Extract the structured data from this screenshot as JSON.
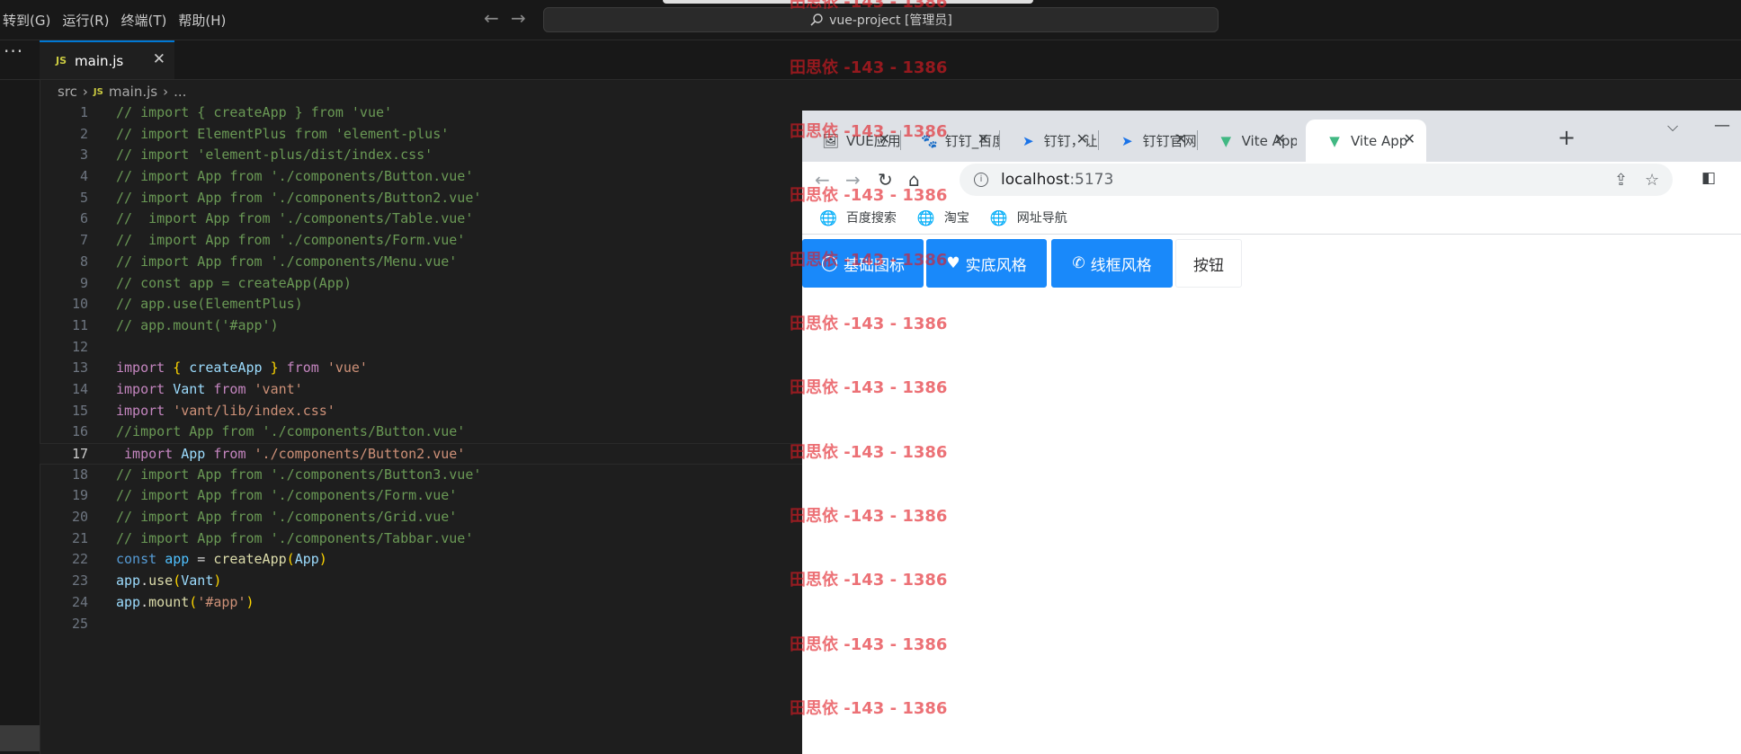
{
  "vscode": {
    "menu": [
      "转到(G)",
      "运行(R)",
      "终端(T)",
      "帮助(H)"
    ],
    "command_center": "vue-project [管理员]",
    "tab": {
      "label": "main.js",
      "badge": "JS"
    },
    "breadcrumb": {
      "folder": "src",
      "badge": "JS",
      "file": "main.js",
      "rest": "..."
    },
    "active_line": 17,
    "code": [
      [
        [
          "cm",
          "// import { createApp } from 'vue'"
        ]
      ],
      [
        [
          "cm",
          "// import ElementPlus from 'element-plus'"
        ]
      ],
      [
        [
          "cm",
          "// import 'element-plus/dist/index.css'"
        ]
      ],
      [
        [
          "cm",
          "// import App from './components/Button.vue'"
        ]
      ],
      [
        [
          "cm",
          "// import App from './components/Button2.vue'"
        ]
      ],
      [
        [
          "cm",
          "//  import App from './components/Table.vue'"
        ]
      ],
      [
        [
          "cm",
          "//  import App from './components/Form.vue'"
        ]
      ],
      [
        [
          "cm",
          "// import App from './components/Menu.vue'"
        ]
      ],
      [
        [
          "cm",
          "// const app = createApp(App)"
        ]
      ],
      [
        [
          "cm",
          "// app.use(ElementPlus)"
        ]
      ],
      [
        [
          "cm",
          "// app.mount('#app')"
        ]
      ],
      [],
      [
        [
          "kw",
          "import"
        ],
        [
          "pl",
          " "
        ],
        [
          "pn",
          "{"
        ],
        [
          "pl",
          " "
        ],
        [
          "id",
          "createApp"
        ],
        [
          "pl",
          " "
        ],
        [
          "pn",
          "}"
        ],
        [
          "pl",
          " "
        ],
        [
          "kw",
          "from"
        ],
        [
          "pl",
          " "
        ],
        [
          "st",
          "'vue'"
        ]
      ],
      [
        [
          "kw",
          "import"
        ],
        [
          "pl",
          " "
        ],
        [
          "id",
          "Vant"
        ],
        [
          "pl",
          " "
        ],
        [
          "kw",
          "from"
        ],
        [
          "pl",
          " "
        ],
        [
          "st",
          "'vant'"
        ]
      ],
      [
        [
          "kw",
          "import"
        ],
        [
          "pl",
          " "
        ],
        [
          "st",
          "'vant/lib/index.css'"
        ]
      ],
      [
        [
          "cm",
          "//import App from './components/Button.vue'"
        ]
      ],
      [
        [
          "pl",
          " "
        ],
        [
          "kw",
          "import"
        ],
        [
          "pl",
          " "
        ],
        [
          "id",
          "App"
        ],
        [
          "pl",
          " "
        ],
        [
          "kw",
          "from"
        ],
        [
          "pl",
          " "
        ],
        [
          "st",
          "'./components/Button2.vue'"
        ]
      ],
      [
        [
          "cm",
          "// import App from './components/Button3.vue'"
        ]
      ],
      [
        [
          "cm",
          "// import App from './components/Form.vue'"
        ]
      ],
      [
        [
          "cm",
          "// import App from './components/Grid.vue'"
        ]
      ],
      [
        [
          "cm",
          "// import App from './components/Tabbar.vue'"
        ]
      ],
      [
        [
          "bl",
          "const"
        ],
        [
          "pl",
          " "
        ],
        [
          "ct",
          "app"
        ],
        [
          "pl",
          " = "
        ],
        [
          "fn",
          "createApp"
        ],
        [
          "pn",
          "("
        ],
        [
          "id",
          "App"
        ],
        [
          "pn",
          ")"
        ]
      ],
      [
        [
          "id",
          "app"
        ],
        [
          "pl",
          "."
        ],
        [
          "fn",
          "use"
        ],
        [
          "pn",
          "("
        ],
        [
          "id",
          "Vant"
        ],
        [
          "pn",
          ")"
        ]
      ],
      [
        [
          "id",
          "app"
        ],
        [
          "pl",
          "."
        ],
        [
          "fn",
          "mount"
        ],
        [
          "pn",
          "("
        ],
        [
          "st",
          "'#app'"
        ],
        [
          "pn",
          ")"
        ]
      ],
      []
    ]
  },
  "browser": {
    "tabs": [
      {
        "icon": "🖼",
        "title": "VUE应用",
        "active": false
      },
      {
        "icon": "🐾",
        "title": "钉钉_百度",
        "active": false
      },
      {
        "icon": "➤",
        "title": "钉钉，让",
        "active": false
      },
      {
        "icon": "➤",
        "title": "钉钉官网",
        "active": false
      },
      {
        "icon": "▼",
        "title": "Vite App",
        "active": false
      },
      {
        "icon": "▼",
        "title": "Vite App",
        "active": true
      }
    ],
    "url_host": "localhost",
    "url_port": ":5173",
    "bookmarks": [
      "百度搜索",
      "淘宝",
      "网址导航"
    ]
  },
  "page": {
    "buttons": [
      {
        "label": "基础图标",
        "icon": "◯",
        "style": "primary"
      },
      {
        "label": "实底风格",
        "icon": "♥",
        "style": "primary"
      },
      {
        "label": "线框风格",
        "icon": "✆",
        "style": "primary"
      },
      {
        "label": "按钮",
        "icon": "",
        "style": "plain"
      }
    ]
  },
  "watermark": "田思依 -143 - 1386",
  "colors": {
    "vant_primary": "#1989fa",
    "vscode_accent": "#0078d4",
    "watermark": "#e21b23"
  }
}
